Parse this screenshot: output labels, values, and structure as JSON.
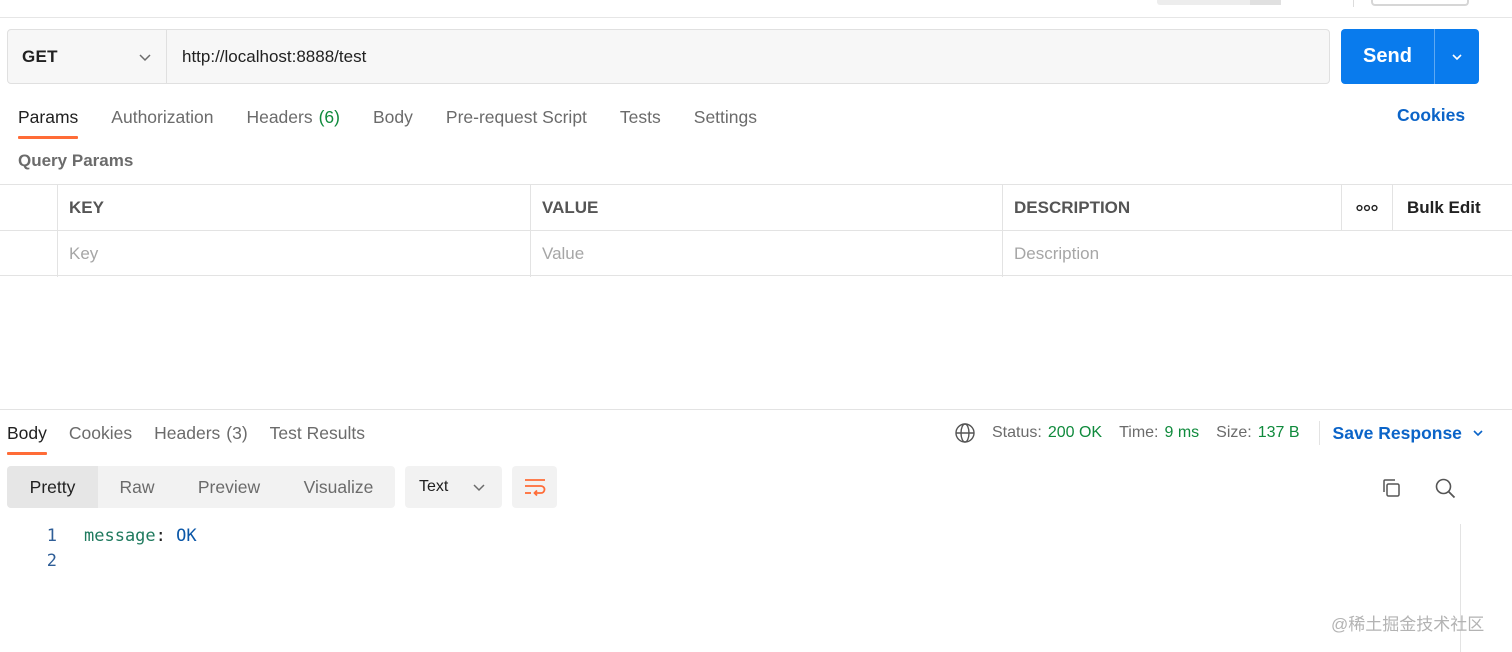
{
  "request": {
    "method": "GET",
    "url": "http://localhost:8888/test",
    "send_label": "Send",
    "cookies_label": "Cookies"
  },
  "request_tabs": [
    {
      "label": "Params",
      "count": "",
      "active": true
    },
    {
      "label": "Authorization",
      "count": ""
    },
    {
      "label": "Headers",
      "count": "(6)"
    },
    {
      "label": "Body",
      "count": ""
    },
    {
      "label": "Pre-request Script",
      "count": ""
    },
    {
      "label": "Tests",
      "count": ""
    },
    {
      "label": "Settings",
      "count": ""
    }
  ],
  "query_params": {
    "title": "Query Params",
    "headers": {
      "key": "KEY",
      "value": "VALUE",
      "description": "DESCRIPTION"
    },
    "bulk_edit": "Bulk Edit",
    "placeholders": {
      "key": "Key",
      "value": "Value",
      "description": "Description"
    }
  },
  "response_tabs": [
    {
      "label": "Body",
      "count": "",
      "active": true
    },
    {
      "label": "Cookies",
      "count": ""
    },
    {
      "label": "Headers",
      "count": "(3)"
    },
    {
      "label": "Test Results",
      "count": ""
    }
  ],
  "response_meta": {
    "status_label": "Status:",
    "status_value": "200 OK",
    "time_label": "Time:",
    "time_value": "9 ms",
    "size_label": "Size:",
    "size_value": "137 B",
    "save_response": "Save Response"
  },
  "view_modes": [
    "Pretty",
    "Raw",
    "Preview",
    "Visualize"
  ],
  "format": "Text",
  "code_lines": [
    {
      "number": "1",
      "key": "message",
      "sep": ": ",
      "value": "OK"
    },
    {
      "number": "2",
      "key": "",
      "sep": "",
      "value": ""
    }
  ],
  "watermark": "@稀土掘金技术社区",
  "colors": {
    "accent": "#097bed",
    "tab_indicator": "#ff6c37",
    "link": "#0b64c8",
    "status_ok": "#0f8a3c"
  }
}
